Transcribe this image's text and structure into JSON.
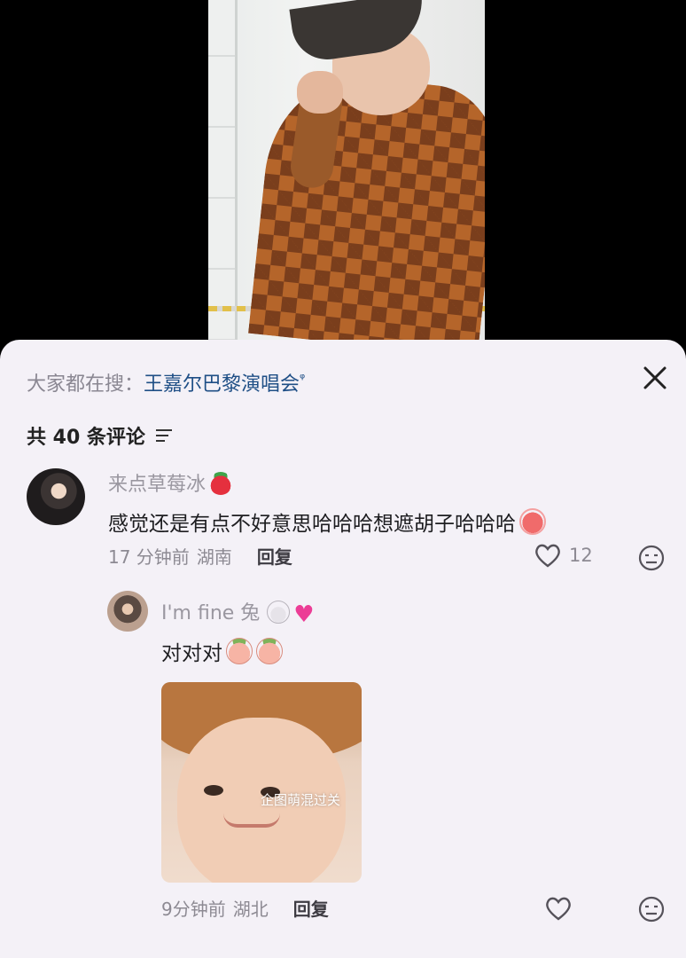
{
  "search": {
    "prefix": "大家都在搜：",
    "term": "王嘉尔巴黎演唱会",
    "search_glyph": "ᵠ"
  },
  "comments_header": {
    "count_label": "共 40 条评论"
  },
  "comments": [
    {
      "username": "来点草莓冰",
      "text": "感觉还是有点不好意思哈哈哈想遮胡子哈哈哈",
      "time": "17 分钟前",
      "location": "湖南",
      "reply_label": "回复",
      "likes": "12"
    }
  ],
  "replies": [
    {
      "username": "I'm fine 兔",
      "text": "对对对",
      "image_watermark": "企图萌混过关",
      "time": "9分钟前",
      "location": "湖北",
      "reply_label": "回复"
    }
  ],
  "colors": {
    "sheet_bg": "#f4f1f7",
    "search_term": "#1f4f86",
    "username": "#9a97a0"
  }
}
